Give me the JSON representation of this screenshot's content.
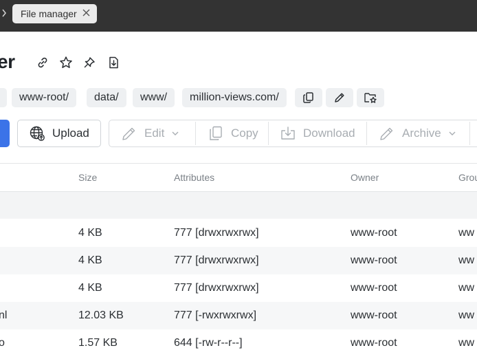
{
  "tab": {
    "title": "File manager",
    "close": "✕"
  },
  "page": {
    "title_fragment": "er"
  },
  "breadcrumbs": [
    "www-root/",
    "data/",
    "www/",
    "million-views.com/"
  ],
  "toolbar": {
    "upload": "Upload",
    "edit": "Edit",
    "copy": "Copy",
    "download": "Download",
    "archive": "Archive"
  },
  "table": {
    "columns": {
      "size": "Size",
      "attributes": "Attributes",
      "owner": "Owner",
      "group": "Grou"
    },
    "rows": [
      {
        "name": "",
        "size": "4 KB",
        "attributes": "777 [drwxrwxrwx]",
        "owner": "www-root",
        "group": "ww"
      },
      {
        "name": "",
        "size": "4 KB",
        "attributes": "777 [drwxrwxrwx]",
        "owner": "www-root",
        "group": "ww"
      },
      {
        "name": "",
        "size": "4 KB",
        "attributes": "777 [drwxrwxrwx]",
        "owner": "www-root",
        "group": "ww"
      },
      {
        "name": "nl",
        "size": "12.03 KB",
        "attributes": "777 [-rwxrwxrwx]",
        "owner": "www-root",
        "group": "ww"
      },
      {
        "name": "o",
        "size": "1.57 KB",
        "attributes": "644 [-rw-r--r--]",
        "owner": "www-root",
        "group": "ww"
      }
    ]
  }
}
